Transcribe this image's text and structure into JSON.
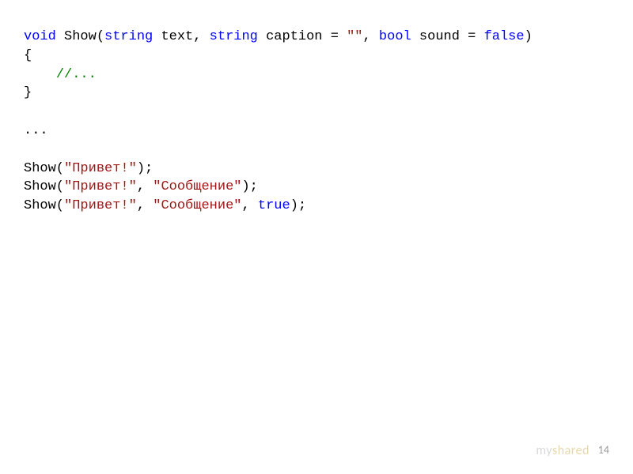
{
  "code": {
    "line1": {
      "kw_void": "void",
      "fn": " Show(",
      "kw_string1": "string",
      "p1": " text, ",
      "kw_string2": "string",
      "p2": " caption = ",
      "str_empty": "\"\"",
      "p3": ", ",
      "kw_bool": "bool",
      "p4": " sound = ",
      "kw_false": "false",
      "p5": ")"
    },
    "line2": "{",
    "line3_indent": "    ",
    "line3_comment": "//...",
    "line4": "}",
    "line5": "",
    "line6": "...",
    "line7": "",
    "line8": {
      "pre": "Show(",
      "str": "\"Привет!\"",
      "post": ");"
    },
    "line9": {
      "pre": "Show(",
      "str1": "\"Привет!\"",
      "sep1": ", ",
      "str2": "\"Сообщение\"",
      "post": ");"
    },
    "line10": {
      "pre": "Show(",
      "str1": "\"Привет!\"",
      "sep1": ", ",
      "str2": "\"Сообщение\"",
      "sep2": ", ",
      "kw_true": "true",
      "post": ");"
    }
  },
  "page_number": "14",
  "watermark": {
    "my": "my",
    "shared": "shared"
  }
}
